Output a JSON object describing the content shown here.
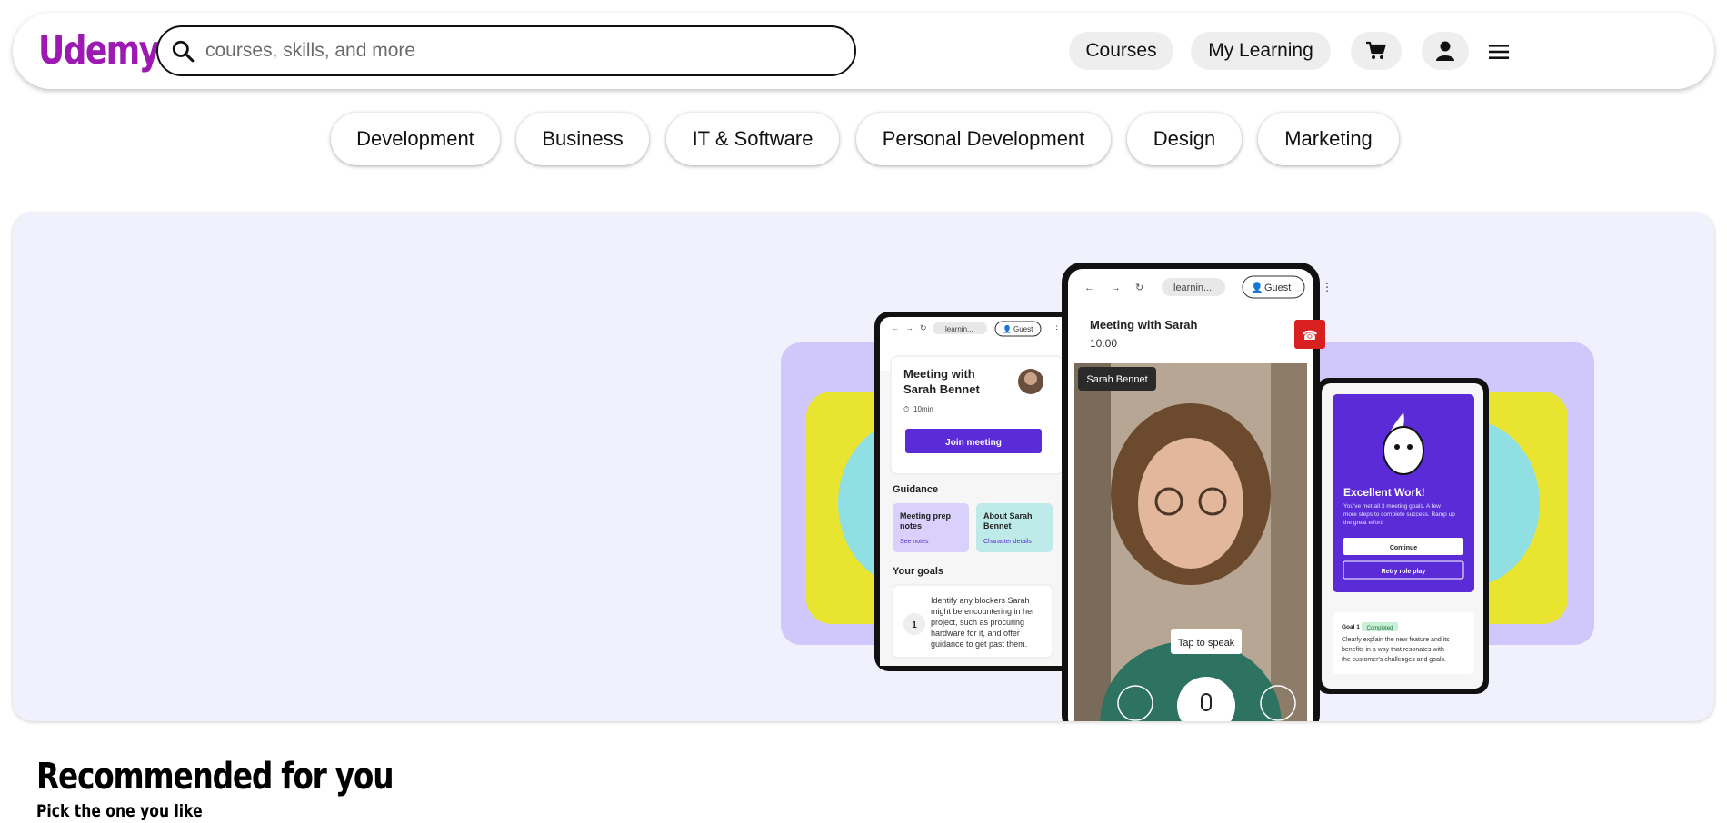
{
  "header": {
    "logo_text": "Udemy",
    "search_placeholder": "courses, skills, and more",
    "nav": {
      "courses_label": "Courses",
      "my_learning_label": "My Learning"
    }
  },
  "categories": [
    "Development",
    "Business",
    "IT & Software",
    "Personal Development",
    "Design",
    "Marketing"
  ],
  "hero": {
    "left_phone": {
      "url": "learnin...",
      "guest": "Guest",
      "meeting_title_1": "Meeting with",
      "meeting_title_2": "Sarah Bennet",
      "duration": "10min",
      "join_label": "Join meeting",
      "guidance_heading": "Guidance",
      "card1_title_1": "Meeting prep",
      "card1_title_2": "notes",
      "card1_link": "See notes",
      "card2_title_1": "About Sarah",
      "card2_title_2": "Bennet",
      "card2_link": "Character details",
      "goals_heading": "Your goals",
      "goal_number": "1",
      "goal_text_1": "Identify any blockers Sarah",
      "goal_text_2": "might be encountering in her",
      "goal_text_3": "project, such as procuring",
      "goal_text_4": "hardware for it, and offer",
      "goal_text_5": "guidance to get past them."
    },
    "center_phone": {
      "url": "learnin...",
      "guest": "Guest",
      "meeting_title": "Meeting with Sarah",
      "time": "10:00",
      "name_tag": "Sarah Bennet",
      "tap_label": "Tap to speak"
    },
    "right_phone": {
      "title": "Excellent Work!",
      "desc_1": "You've met all 3 meeting goals. A few",
      "desc_2": "more steps to complete success. Ramp up",
      "desc_3": "the great effort!",
      "continue_label": "Continue",
      "retry_label": "Retry role play",
      "goal_label": "Goal 1",
      "goal_badge": "Completed",
      "goal_text_1": "Clearly explain the new feature and its",
      "goal_text_2": "benefits in a way that resonates with",
      "goal_text_3": "the customer's challenges and goals."
    }
  },
  "recommended": {
    "title": "Recommended for you",
    "subtitle": "Pick the one you like"
  },
  "colors": {
    "brand": "#9c1ab1",
    "hero_bg": "#f1f0fd",
    "purple": "#6b2ad8",
    "lavender": "#d0c8fb",
    "yellow": "#e9e42f",
    "cyan": "#8fdfe3",
    "red": "#d92020"
  }
}
